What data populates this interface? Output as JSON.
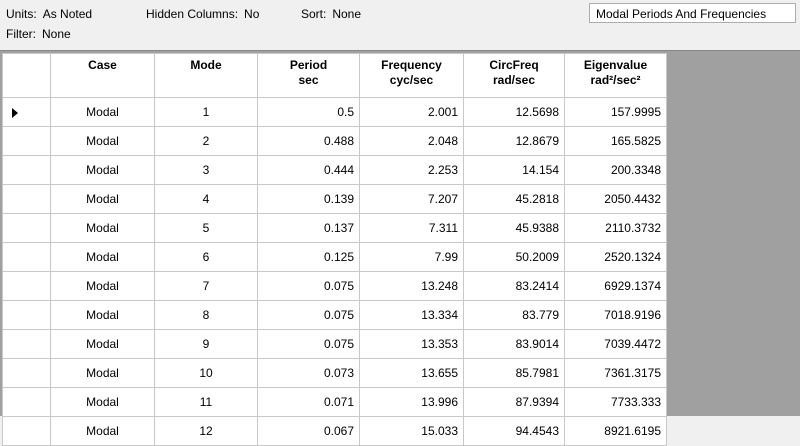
{
  "toolbar": {
    "units_label": "Units:",
    "units_value": "As Noted",
    "hidden_label": "Hidden Columns:",
    "hidden_value": "No",
    "sort_label": "Sort:",
    "sort_value": "None",
    "filter_label": "Filter:",
    "filter_value": "None",
    "table_select": "Modal Periods And Frequencies"
  },
  "columns": [
    {
      "l1": "Case",
      "l2": ""
    },
    {
      "l1": "Mode",
      "l2": ""
    },
    {
      "l1": "Period",
      "l2": "sec"
    },
    {
      "l1": "Frequency",
      "l2": "cyc/sec"
    },
    {
      "l1": "CircFreq",
      "l2": "rad/sec"
    },
    {
      "l1": "Eigenvalue",
      "l2": "rad²/sec²"
    }
  ],
  "rows": [
    [
      "Modal",
      "1",
      "0.5",
      "2.001",
      "12.5698",
      "157.9995"
    ],
    [
      "Modal",
      "2",
      "0.488",
      "2.048",
      "12.8679",
      "165.5825"
    ],
    [
      "Modal",
      "3",
      "0.444",
      "2.253",
      "14.154",
      "200.3348"
    ],
    [
      "Modal",
      "4",
      "0.139",
      "7.207",
      "45.2818",
      "2050.4432"
    ],
    [
      "Modal",
      "5",
      "0.137",
      "7.311",
      "45.9388",
      "2110.3732"
    ],
    [
      "Modal",
      "6",
      "0.125",
      "7.99",
      "50.2009",
      "2520.1324"
    ],
    [
      "Modal",
      "7",
      "0.075",
      "13.248",
      "83.2414",
      "6929.1374"
    ],
    [
      "Modal",
      "8",
      "0.075",
      "13.334",
      "83.779",
      "7018.9196"
    ],
    [
      "Modal",
      "9",
      "0.075",
      "13.353",
      "83.9014",
      "7039.4472"
    ],
    [
      "Modal",
      "10",
      "0.073",
      "13.655",
      "85.7981",
      "7361.3175"
    ],
    [
      "Modal",
      "11",
      "0.071",
      "13.996",
      "87.9394",
      "7733.333"
    ],
    [
      "Modal",
      "12",
      "0.067",
      "15.033",
      "94.4543",
      "8921.6195"
    ]
  ],
  "selected_row": 0
}
